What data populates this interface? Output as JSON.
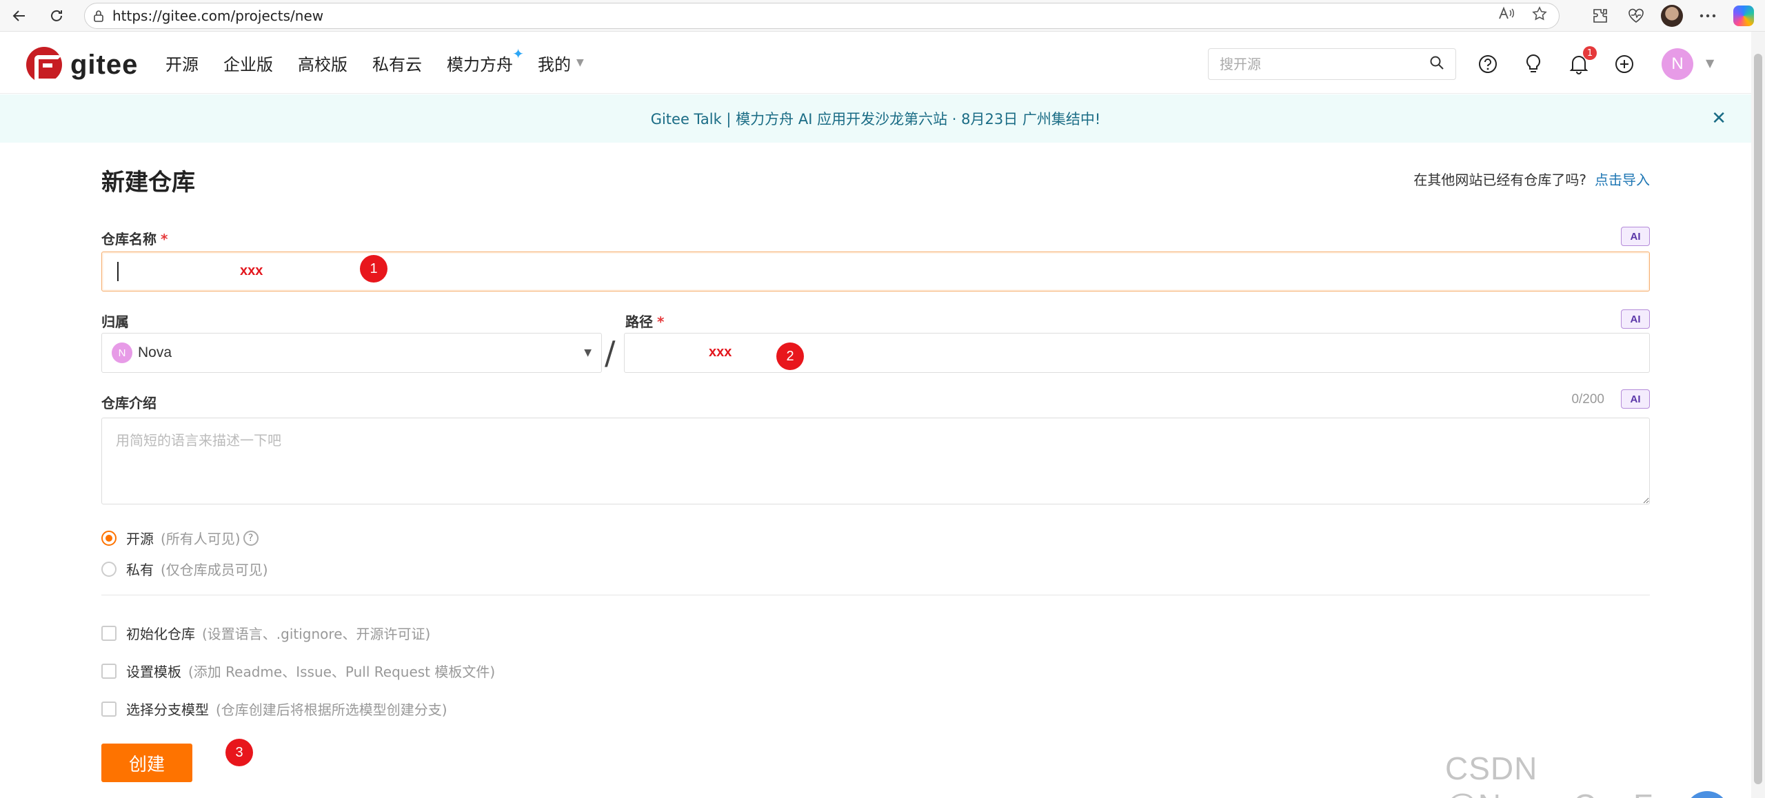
{
  "browser": {
    "url": "https://gitee.com/projects/new"
  },
  "header": {
    "logo_text": "gitee",
    "nav": [
      "开源",
      "企业版",
      "高校版",
      "私有云",
      "模力方舟",
      "我的"
    ],
    "search_placeholder": "搜开源",
    "notification_count": "1",
    "user_initial": "N"
  },
  "announcement": {
    "text": "Gitee Talk | 模力方舟 AI 应用开发沙龙第六站 · 8月23日 广州集结中!",
    "close": "✕"
  },
  "form": {
    "title": "新建仓库",
    "import_hint": "在其他网站已经有仓库了吗?",
    "import_link": "点击导入",
    "ai_label": "AI",
    "required_mark": "*",
    "repo_name_label": "仓库名称",
    "repo_name_annotation": "xxx",
    "owner_label": "归属",
    "owner_initial": "N",
    "owner_name": "Nova",
    "path_separator": "/",
    "path_label": "路径",
    "path_annotation": "xxx",
    "description_label": "仓库介绍",
    "description_counter": "0/200",
    "description_placeholder": "用简短的语言来描述一下吧",
    "visibility": [
      {
        "label": "开源",
        "hint": "(所有人可见)",
        "checked": true
      },
      {
        "label": "私有",
        "hint": "(仅仓库成员可见)",
        "checked": false
      }
    ],
    "options": [
      {
        "label": "初始化仓库",
        "hint": "(设置语言、.gitignore、开源许可证)"
      },
      {
        "label": "设置模板",
        "hint": "(添加 Readme、Issue、Pull Request 模板文件)"
      },
      {
        "label": "选择分支模型",
        "hint": "(仓库创建后将根据所选模型创建分支)"
      }
    ],
    "create_button": "创建"
  },
  "markers": [
    "1",
    "2",
    "3"
  ],
  "watermark": "CSDN @Nova_CaoFc",
  "colors": {
    "brand": "#c71d23",
    "primary": "#fe7300",
    "annotation_red": "#e8161c",
    "announce_bg": "#eefbfa",
    "avatar": "#e79be7"
  }
}
